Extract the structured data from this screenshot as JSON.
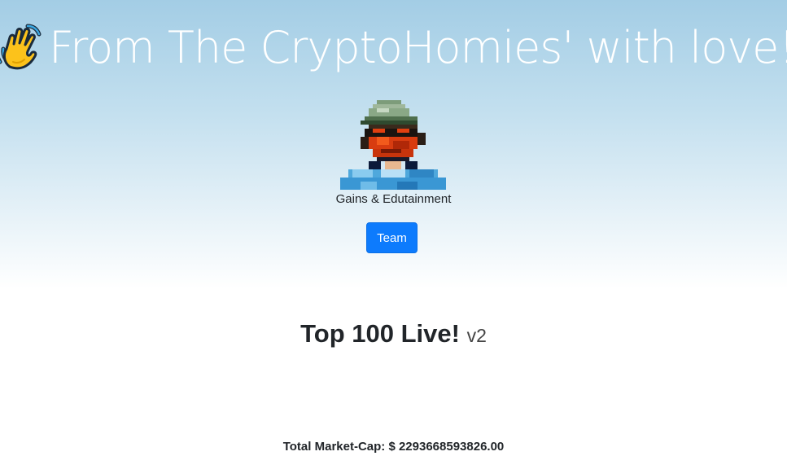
{
  "hero": {
    "title": "From The CryptoHomies' with love!",
    "wave_icon": "waving-hand-emoji",
    "avatar_icon": "pixel-art-avatar",
    "tagline": "Gains & Edutainment",
    "team_button_label": "Team"
  },
  "main": {
    "title": "Top 100 Live!",
    "version": "v2",
    "market_cap_label": "Total Market-Cap: $ 2293668593826.00"
  },
  "colors": {
    "hero_gradient_top": "#a3cde5",
    "button_primary": "#0d7bfd",
    "headline_text": "#ffffff"
  }
}
